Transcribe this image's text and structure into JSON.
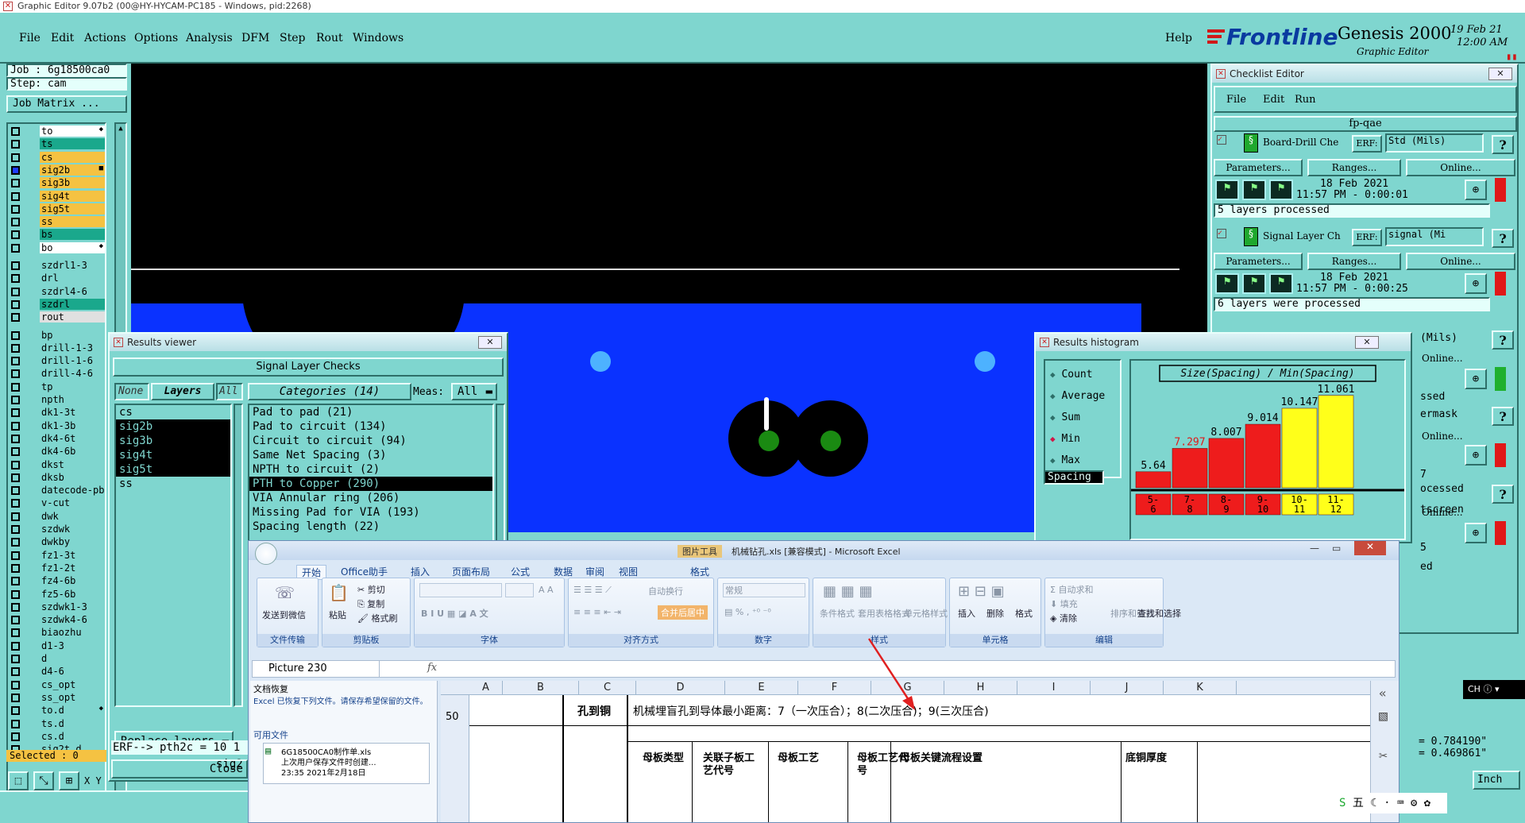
{
  "title_bar": "Graphic Editor 9.07b2 (00@HY-HYCAM-PC185 - Windows, pid:2268)",
  "menu": [
    "File",
    "Edit",
    "Actions",
    "Options",
    "Analysis",
    "DFM",
    "Step",
    "Rout",
    "Windows"
  ],
  "help": "Help",
  "brand": {
    "logo": "Frontline",
    "product": "Genesis 2000",
    "sub": "Graphic Editor",
    "date": "19 Feb 21",
    "time": "12:00 AM",
    "accent": "#d01818"
  },
  "job": {
    "job": "Job : 6g18500ca0",
    "step": "Step: cam",
    "matrix": "Job Matrix ..."
  },
  "layers": [
    {
      "name": "to",
      "color": "#ffffff",
      "mark": "◆"
    },
    {
      "name": "ts",
      "color": "#1aa88c"
    },
    {
      "name": "cs",
      "color": "#f5c242"
    },
    {
      "name": "sig2b",
      "color": "#f5c242",
      "mark": "■",
      "active": true
    },
    {
      "name": "sig3b",
      "color": "#f5c242"
    },
    {
      "name": "sig4t",
      "color": "#f5c242"
    },
    {
      "name": "sig5t",
      "color": "#f5c242"
    },
    {
      "name": "ss",
      "color": "#f5c242"
    },
    {
      "name": "bs",
      "color": "#1aa88c"
    },
    {
      "name": "bo",
      "color": "#ffffff",
      "mark": "◆"
    },
    {
      "name": "szdrl1-3",
      "color": "#7fd6cf",
      "gap": true
    },
    {
      "name": "drl",
      "color": "#7fd6cf"
    },
    {
      "name": "szdrl4-6",
      "color": "#7fd6cf"
    },
    {
      "name": "szdrl",
      "color": "#1aa88c",
      "green": true
    },
    {
      "name": "rout",
      "color": "#e0e0e0"
    },
    {
      "name": "bp",
      "color": "#7fd6cf",
      "gap": true
    },
    {
      "name": "drill-1-3",
      "color": "#7fd6cf"
    },
    {
      "name": "drill-1-6",
      "color": "#7fd6cf"
    },
    {
      "name": "drill-4-6",
      "color": "#7fd6cf"
    },
    {
      "name": "tp",
      "color": "#7fd6cf"
    },
    {
      "name": "npth",
      "color": "#7fd6cf"
    },
    {
      "name": "dk1-3t",
      "color": "#7fd6cf"
    },
    {
      "name": "dk1-3b",
      "color": "#7fd6cf"
    },
    {
      "name": "dk4-6t",
      "color": "#7fd6cf"
    },
    {
      "name": "dk4-6b",
      "color": "#7fd6cf"
    },
    {
      "name": "dkst",
      "color": "#7fd6cf"
    },
    {
      "name": "dksb",
      "color": "#7fd6cf"
    },
    {
      "name": "datecode-pb",
      "color": "#7fd6cf"
    },
    {
      "name": "v-cut",
      "color": "#7fd6cf"
    },
    {
      "name": "dwk",
      "color": "#7fd6cf"
    },
    {
      "name": "szdwk",
      "color": "#7fd6cf"
    },
    {
      "name": "dwkby",
      "color": "#7fd6cf"
    },
    {
      "name": "fz1-3t",
      "color": "#7fd6cf"
    },
    {
      "name": "fz1-2t",
      "color": "#7fd6cf"
    },
    {
      "name": "fz4-6b",
      "color": "#7fd6cf"
    },
    {
      "name": "fz5-6b",
      "color": "#7fd6cf"
    },
    {
      "name": "szdwk1-3",
      "color": "#7fd6cf"
    },
    {
      "name": "szdwk4-6",
      "color": "#7fd6cf"
    },
    {
      "name": "biaozhu",
      "color": "#7fd6cf"
    },
    {
      "name": "d1-3",
      "color": "#7fd6cf"
    },
    {
      "name": "d",
      "color": "#7fd6cf"
    },
    {
      "name": "d4-6",
      "color": "#7fd6cf"
    },
    {
      "name": "cs_opt",
      "color": "#7fd6cf"
    },
    {
      "name": "ss_opt",
      "color": "#7fd6cf"
    },
    {
      "name": "to.d",
      "color": "#7fd6cf",
      "mark": "◆"
    },
    {
      "name": "ts.d",
      "color": "#7fd6cf"
    },
    {
      "name": "cs.d",
      "color": "#7fd6cf"
    },
    {
      "name": "sig2t.d",
      "color": "#7fd6cf"
    }
  ],
  "selected": "Selected : 0",
  "results_viewer": {
    "title": "Results viewer",
    "header": "Signal Layer Checks",
    "none": "None",
    "layers": "Layers",
    "all": "All",
    "categories_label": "Categories (14)",
    "meas_label": "Meas:",
    "meas_value": "All",
    "layer_list": [
      "cs",
      "sig2b",
      "sig3b",
      "sig4t",
      "sig5t",
      "ss"
    ],
    "categories": [
      "Pad to pad (21)",
      "Pad to circuit (134)",
      "Circuit to circuit (94)",
      "Same Net Spacing (3)",
      "NPTH to circuit (2)",
      "PTH to Copper (290)",
      "VIA Annular ring (206)",
      "Missing Pad for VIA (193)",
      "Spacing length (22)"
    ],
    "replace": "Replace layers",
    "erf_prefix": "sig2",
    "erf": "ERF--> pth2c = 10 1",
    "close": "Close"
  },
  "checklist": {
    "title": "Checklist Editor",
    "menu": [
      "File",
      "Edit",
      "Run"
    ],
    "name": "fp-qae",
    "items": [
      {
        "label": "Board-Drill Che",
        "erf": "ERF:",
        "std": "Std (Mils)",
        "params": "Parameters...",
        "ranges": "Ranges...",
        "online": "Online...",
        "date": "18 Feb 2021",
        "time": "11:57 PM - 0:00:01",
        "status": "5 layers processed"
      },
      {
        "label": "Signal Layer Ch",
        "erf": "ERF:",
        "std": "signal (Mi",
        "params": "Parameters...",
        "ranges": "Ranges...",
        "online": "Online...",
        "date": "18 Feb 2021",
        "time": "11:57 PM - 0:00:25",
        "status": "6 layers were processed"
      }
    ],
    "partial": [
      "(Mils)",
      "Online...",
      "ssed",
      "ermask",
      "Online...",
      "7",
      "ocessed",
      "tscreen",
      "Online...",
      "5",
      "ed"
    ],
    "help": "?"
  },
  "histogram": {
    "title": "Results histogram",
    "modes": [
      "Count",
      "Average",
      "Sum",
      "Min",
      "Max"
    ],
    "selected_mode": "Min",
    "measure": "Spacing",
    "chart_title": "Size(Spacing) / Min(Spacing)",
    "chart_data": {
      "type": "bar",
      "title": "Size(Spacing) / Min(Spacing)",
      "categories": [
        "5-6",
        "7-8",
        "8-9",
        "9-10",
        "10-11",
        "11-12"
      ],
      "values": [
        5.64,
        7.297,
        8.007,
        9.014,
        10.147,
        11.061
      ],
      "colors": [
        "#ee1c1c",
        "#ee1c1c",
        "#ee1c1c",
        "#ee1c1c",
        "#ffff1a",
        "#ffff1a"
      ],
      "ylim": [
        0,
        11.5
      ]
    }
  },
  "excel": {
    "title": "机械钻孔.xls [兼容模式] - Microsoft Excel",
    "context_tab": "图片工具",
    "tabs": [
      "开始",
      "Office助手",
      "插入",
      "页面布局",
      "公式",
      "数据",
      "审阅",
      "视图",
      "格式"
    ],
    "groups": {
      "a": "文件传输",
      "b": "剪贴板",
      "c": "字体",
      "d": "对齐方式",
      "e": "数字",
      "f": "样式",
      "g": "单元格",
      "h": "编辑"
    },
    "btns": {
      "send": "发送到微信",
      "paste": "粘贴",
      "cut": "剪切",
      "copy": "复制",
      "painter": "格式刷",
      "wrap": "自动换行",
      "merge": "合并后居中",
      "numfmt": "常规",
      "cond": "条件格式",
      "table": "套用表格格式",
      "cellstyle": "单元格样式",
      "insert": "插入",
      "delete": "删除",
      "format": "格式",
      "autosum": "自动求和",
      "fill": "填充",
      "clear": "清除",
      "sort": "排序和筛选",
      "find": "查找和选择"
    },
    "namebox": "Picture 230",
    "fx": "fx",
    "recovery": {
      "title": "文档恢复",
      "msg": "Excel 已恢复下列文件。请保存希望保留的文件。",
      "avail": "可用文件",
      "file": "6G18500CA0制作单.xls",
      "file_note": "上次用户保存文件时创建...",
      "file_time": "23:35 2021年2月18日"
    },
    "cols": [
      "A",
      "B",
      "C",
      "D",
      "E",
      "F",
      "G",
      "H",
      "I",
      "J",
      "K"
    ],
    "row": "50",
    "cell_c": "孔到铜",
    "cell_note": "机械埋盲孔到导体最小距离：7（一次压合）；8(二次压合)；9(三次压合)",
    "headers": [
      "母板类型",
      "关联子板工艺代号",
      "母板工艺",
      "母板工艺代号",
      "母板关键流程设置",
      "底铜厚度"
    ]
  },
  "right_bottom": {
    "x": "= 0.784190\"",
    "y": "= 0.469861\"",
    "units": "Inch",
    "ime": "CH"
  }
}
